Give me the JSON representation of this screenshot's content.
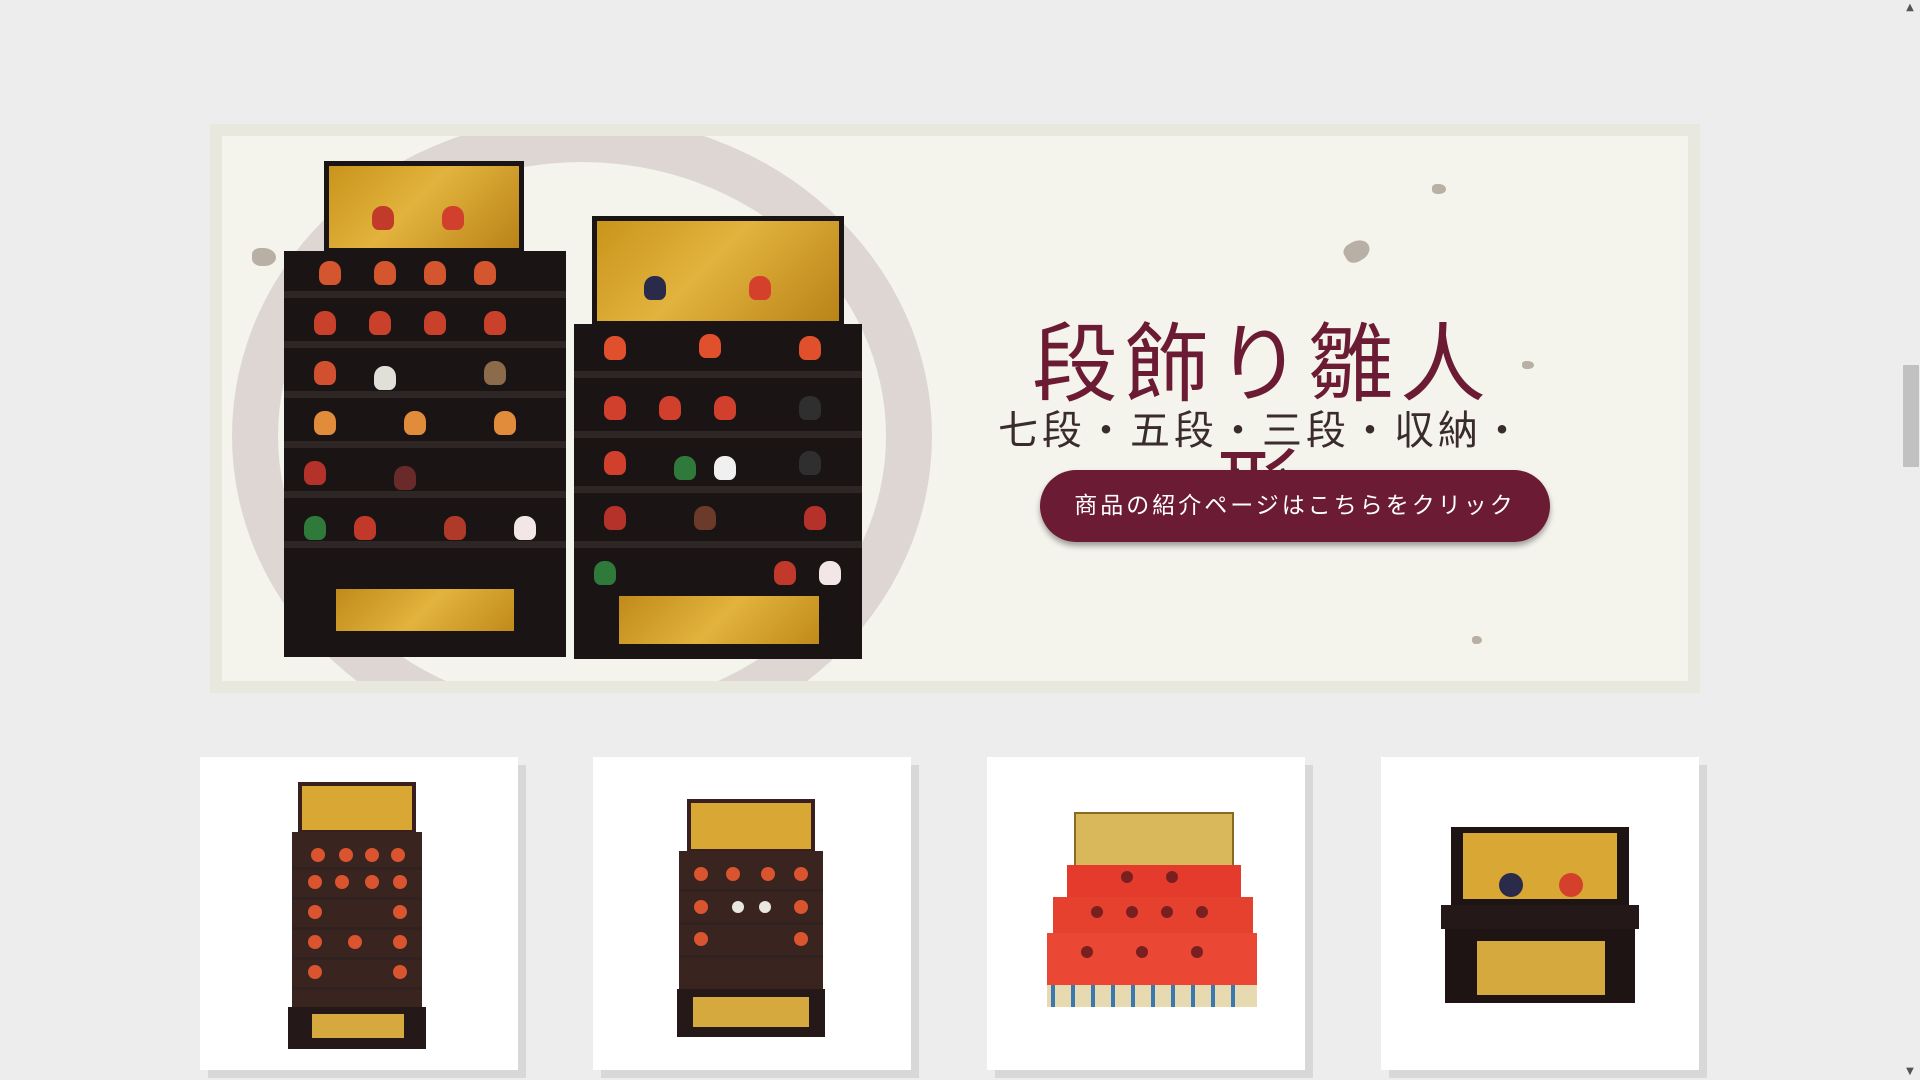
{
  "banner": {
    "title": "段飾り雛人形",
    "subtitle": "七段・五段・三段・収納・高床",
    "button_label": "商品の紹介ページはこちらをクリック",
    "colors": {
      "accent": "#6b1b33",
      "paper": "#f4f3ec"
    },
    "image_name": "hina-doll-tiered-display-image"
  },
  "products": [
    {
      "name": "seven-tier-hina-display",
      "image": "seven-tier-display-image"
    },
    {
      "name": "five-tier-hina-display",
      "image": "five-tier-display-image"
    },
    {
      "name": "three-tier-hina-display",
      "image": "three-tier-red-display-image"
    },
    {
      "name": "storage-hina-display",
      "image": "storage-display-image"
    }
  ],
  "scrollbar": {
    "up_icon": "▲",
    "down_icon": "▼"
  }
}
